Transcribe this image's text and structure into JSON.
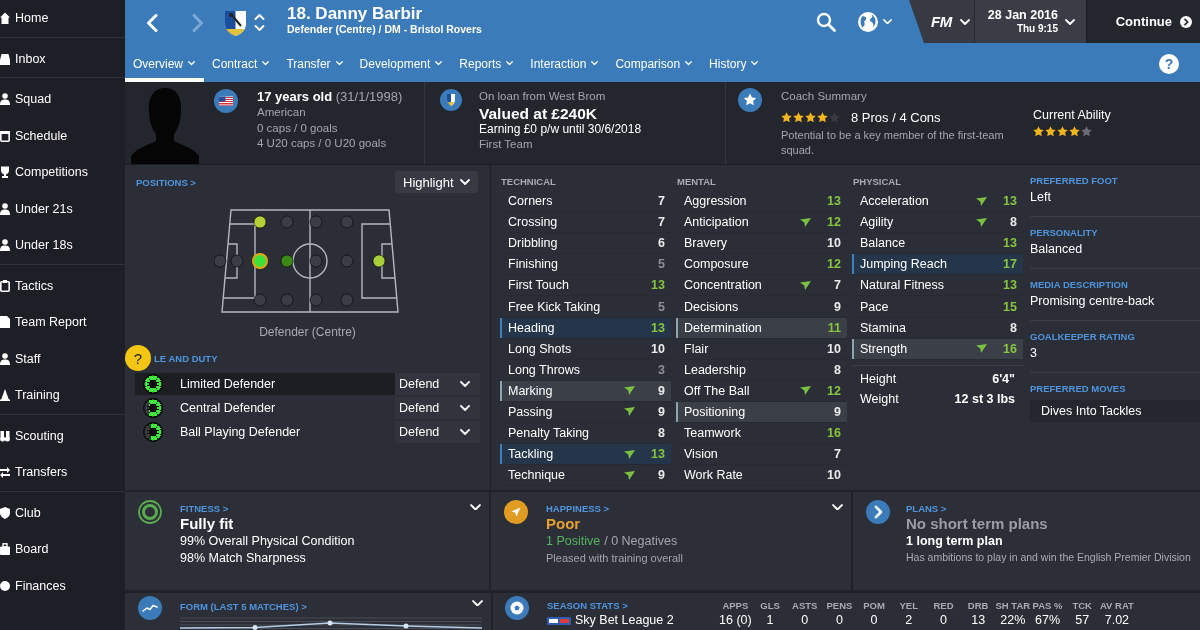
{
  "sidebar": {
    "groups": [
      [
        "Home"
      ],
      [
        "Inbox"
      ],
      [
        "Squad",
        "Schedule",
        "Competitions",
        "Under 21s",
        "Under 18s"
      ],
      [
        "Tactics",
        "Team Report",
        "Staff",
        "Training"
      ],
      [
        "Scouting",
        "Transfers"
      ],
      [
        "Club",
        "Board",
        "Finances"
      ]
    ]
  },
  "header": {
    "back": {
      "disabled": false
    },
    "forward": {
      "disabled": true
    },
    "title": "18. Danny Barbir",
    "subtitle": "Defender (Centre) / DM - Bristol Rovers",
    "logo": "FM",
    "date": "28 Jan 2016",
    "time": "Thu 9:15",
    "continue": "Continue",
    "tabs": [
      {
        "label": "Overview",
        "selected": true
      },
      {
        "label": "Contract",
        "selected": false
      },
      {
        "label": "Transfer",
        "selected": false
      },
      {
        "label": "Development",
        "selected": false
      },
      {
        "label": "Reports",
        "selected": false
      },
      {
        "label": "Interaction",
        "selected": false
      },
      {
        "label": "Comparison",
        "selected": false
      },
      {
        "label": "History",
        "selected": false
      }
    ],
    "help": "?"
  },
  "profile": {
    "age": "**17 years old** (31/1/1998)",
    "nationality": "American",
    "caps": "0 caps / 0 goals",
    "u20_caps": "4 U20 caps / 0 U20 goals"
  },
  "contract": {
    "loan": "On loan from West Brom",
    "value": "Valued at £240K",
    "wage": "Earning £0 p/w until 30/6/2018",
    "squad_status": "First Team"
  },
  "coach": {
    "title": "Coach Summary",
    "stars": 4,
    "pros_cons": "8 Pros / 4 Cons",
    "summary": "Potential to be a key member of the first-team squad."
  },
  "ability": {
    "label": "Current Ability",
    "stars": 4
  },
  "positions": {
    "heading": "POSITIONS >",
    "dropdown": "Highlight",
    "spots": [
      {
        "color": "#b4d236",
        "selected": false
      },
      {
        "color": "#3a3d45",
        "selected": false
      },
      {
        "color": "#3a3d45",
        "selected": false
      },
      {
        "color": "#3a3d45",
        "selected": false
      },
      {
        "color": "#3a3d45",
        "selected": false
      },
      {
        "color": "#3a3d45",
        "selected": false
      },
      {
        "color": "#3fe03b",
        "selected": true
      },
      {
        "color": "#3b8a18",
        "selected": false
      },
      {
        "color": "#3a3d45",
        "selected": false
      },
      {
        "color": "#3a3d45",
        "selected": false
      },
      {
        "color": "#a9cf38",
        "selected": false
      },
      {
        "color": "#3a3d45",
        "selected": false
      },
      {
        "color": "#3a3d45",
        "selected": false
      },
      {
        "color": "#3a3d45",
        "selected": false
      },
      {
        "color": "#3a3d45",
        "selected": false
      }
    ],
    "label": "Defender (Centre)",
    "help": "?",
    "roles_heading": "LE AND DUTY",
    "roles": [
      {
        "name": "Limited Defender",
        "duty": "Defend",
        "level": 1,
        "selected": true
      },
      {
        "name": "Central Defender",
        "duty": "Defend",
        "level": 0.7,
        "selected": false
      },
      {
        "name": "Ball Playing Defender",
        "duty": "Defend",
        "level": 0.6,
        "selected": false
      }
    ]
  },
  "attributes": [
    {
      "heading": "TECHNICAL",
      "items": [
        {
          "name": "Corners",
          "value": "7",
          "rising": false,
          "kind": "plain"
        },
        {
          "name": "Crossing",
          "value": "7",
          "rising": false,
          "kind": "plain"
        },
        {
          "name": "Dribbling",
          "value": "6",
          "rising": false,
          "kind": "plain"
        },
        {
          "name": "Finishing",
          "value": "5",
          "rising": false,
          "kind": "plain"
        },
        {
          "name": "First Touch",
          "value": "13",
          "rising": false,
          "kind": "plain"
        },
        {
          "name": "Free Kick Taking",
          "value": "5",
          "rising": false,
          "kind": "plain"
        },
        {
          "name": "Heading",
          "value": "13",
          "rising": false,
          "kind": "key"
        },
        {
          "name": "Long Shots",
          "value": "10",
          "rising": false,
          "kind": "plain"
        },
        {
          "name": "Long Throws",
          "value": "3",
          "rising": false,
          "kind": "plain"
        },
        {
          "name": "Marking",
          "value": "9",
          "rising": true,
          "kind": "preferable"
        },
        {
          "name": "Passing",
          "value": "9",
          "rising": true,
          "kind": "plain"
        },
        {
          "name": "Penalty Taking",
          "value": "8",
          "rising": false,
          "kind": "plain"
        },
        {
          "name": "Tackling",
          "value": "13",
          "rising": true,
          "kind": "key"
        },
        {
          "name": "Technique",
          "value": "9",
          "rising": true,
          "kind": "plain"
        }
      ]
    },
    {
      "heading": "MENTAL",
      "items": [
        {
          "name": "Aggression",
          "value": "13",
          "rising": false,
          "kind": "plain"
        },
        {
          "name": "Anticipation",
          "value": "12",
          "rising": true,
          "kind": "plain"
        },
        {
          "name": "Bravery",
          "value": "10",
          "rising": false,
          "kind": "plain"
        },
        {
          "name": "Composure",
          "value": "12",
          "rising": false,
          "kind": "plain"
        },
        {
          "name": "Concentration",
          "value": "7",
          "rising": true,
          "kind": "plain"
        },
        {
          "name": "Decisions",
          "value": "9",
          "rising": false,
          "kind": "plain"
        },
        {
          "name": "Determination",
          "value": "11",
          "rising": false,
          "kind": "preferable"
        },
        {
          "name": "Flair",
          "value": "10",
          "rising": false,
          "kind": "plain"
        },
        {
          "name": "Leadership",
          "value": "8",
          "rising": false,
          "kind": "plain"
        },
        {
          "name": "Off The Ball",
          "value": "12",
          "rising": true,
          "kind": "plain"
        },
        {
          "name": "Positioning",
          "value": "9",
          "rising": false,
          "kind": "preferable"
        },
        {
          "name": "Teamwork",
          "value": "16",
          "rising": false,
          "kind": "plain"
        },
        {
          "name": "Vision",
          "value": "7",
          "rising": false,
          "kind": "plain"
        },
        {
          "name": "Work Rate",
          "value": "10",
          "rising": false,
          "kind": "plain"
        }
      ]
    },
    {
      "heading": "PHYSICAL",
      "items": [
        {
          "name": "Acceleration",
          "value": "13",
          "rising": true,
          "kind": "plain"
        },
        {
          "name": "Agility",
          "value": "8",
          "rising": true,
          "kind": "plain"
        },
        {
          "name": "Balance",
          "value": "13",
          "rising": false,
          "kind": "plain"
        },
        {
          "name": "Jumping Reach",
          "value": "17",
          "rising": false,
          "kind": "key"
        },
        {
          "name": "Natural Fitness",
          "value": "13",
          "rising": false,
          "kind": "plain"
        },
        {
          "name": "Pace",
          "value": "15",
          "rising": false,
          "kind": "plain"
        },
        {
          "name": "Stamina",
          "value": "8",
          "rising": false,
          "kind": "plain"
        },
        {
          "name": "Strength",
          "value": "16",
          "rising": true,
          "kind": "preferable"
        }
      ]
    }
  ],
  "physique": [
    {
      "label": "Height",
      "value": "6'4\""
    },
    {
      "label": "Weight",
      "value": "12 st 3 lbs"
    }
  ],
  "details": [
    {
      "kind": "value",
      "label": "PREFERRED FOOT",
      "value": "Left"
    },
    {
      "kind": "value",
      "label": "PERSONALITY",
      "value": "Balanced"
    },
    {
      "kind": "value",
      "label": "MEDIA DESCRIPTION",
      "value": "Promising centre-back"
    },
    {
      "kind": "value",
      "label": "GOALKEEPER RATING",
      "value": "3"
    },
    {
      "kind": "list",
      "label": "PREFERRED MOVES",
      "items": [
        "Dives Into Tackles"
      ]
    }
  ],
  "cards": [
    {
      "kind": "fitness",
      "heading": "FITNESS >",
      "status": "Fully fit",
      "lines": [
        "99% Overall Physical Condition",
        "98% Match Sharpness"
      ],
      "collapsible": true
    },
    {
      "kind": "happiness",
      "heading": "HAPPINESS >",
      "status": "Poor",
      "positive": "1 Positive",
      "negative": "/ 0 Negatives",
      "lines": [
        "Pleased with training overall"
      ],
      "collapsible": true
    },
    {
      "kind": "plans",
      "heading": "PLANS >",
      "status": "No short term plans",
      "subheading": "1 long term plan",
      "lines": [
        "Has ambitions to play in and win the English Premier Division"
      ],
      "collapsible": false
    }
  ],
  "form": {
    "heading": "FORM (LAST 5 MATCHES) >",
    "collapsible": true
  },
  "season_stats": {
    "heading": "SEASON STATS >",
    "columns": [
      "APPS",
      "GLS",
      "ASTS",
      "PENS",
      "POM",
      "YEL",
      "RED",
      "DRB",
      "SH TAR",
      "PAS %",
      "TCK",
      "AV RAT"
    ],
    "rows": [
      {
        "competition": "Sky Bet League 2",
        "values": [
          "16 (0)",
          "1",
          "0",
          "0",
          "0",
          "2",
          "0",
          "13",
          "22%",
          "67%",
          "57",
          "7.02"
        ]
      }
    ]
  }
}
